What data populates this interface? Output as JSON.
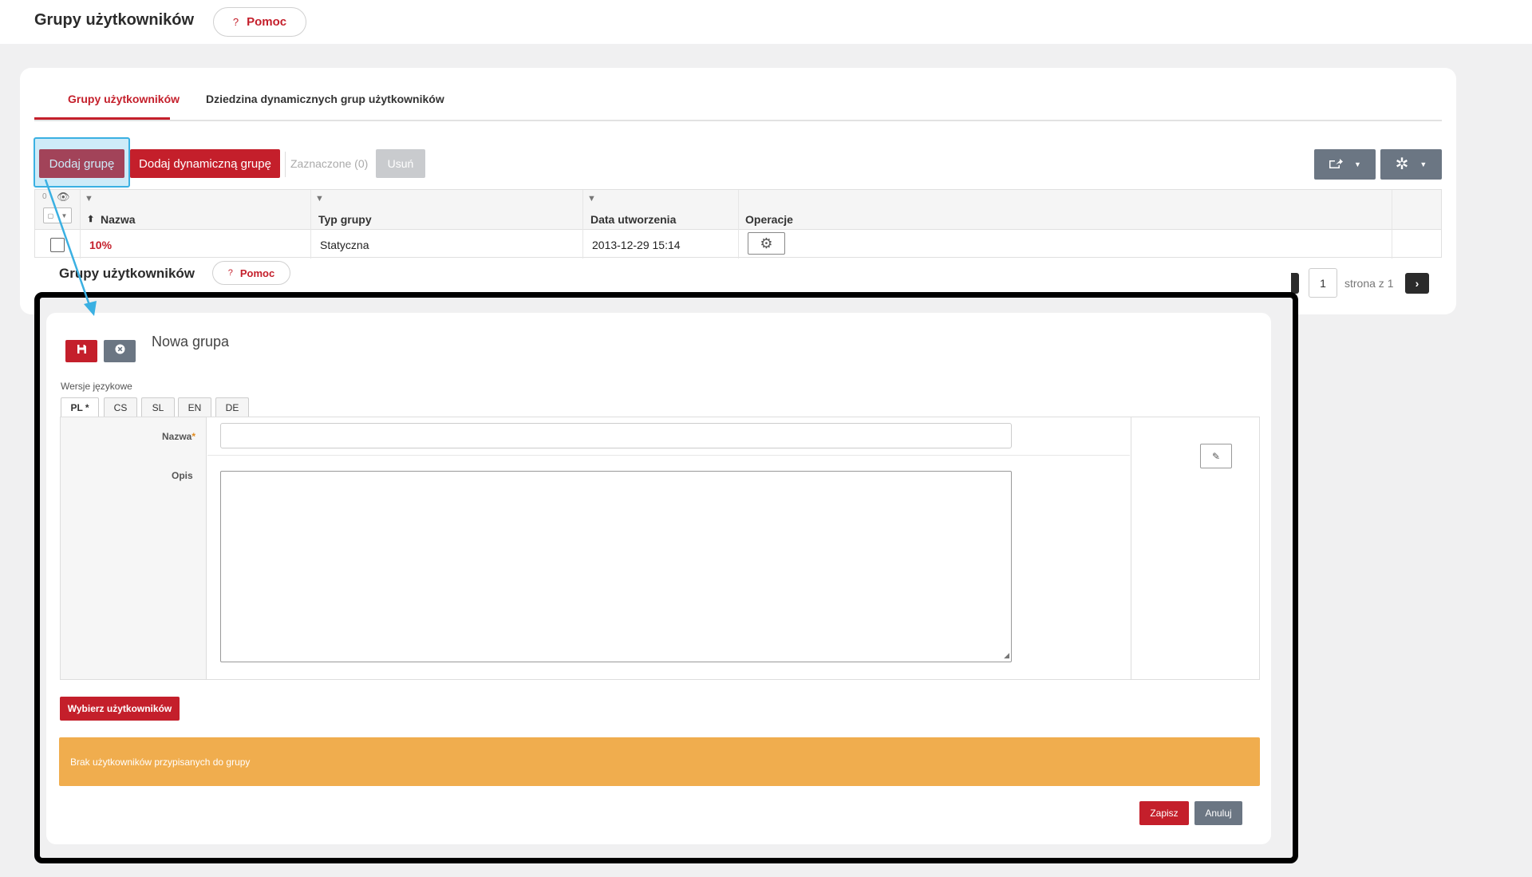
{
  "header": {
    "title": "Grupy użytkowników",
    "help_icon": "?",
    "help_label": "Pomoc"
  },
  "tabs": [
    {
      "label": "Grupy użytkowników",
      "active": true
    },
    {
      "label": "Dziedzina dynamicznych grup użytkowników",
      "active": false
    }
  ],
  "toolbar": {
    "add_group": "Dodaj grupę",
    "add_dynamic_group": "Dodaj dynamiczną grupę",
    "selected": "Zaznaczone (0)",
    "delete": "Usuń",
    "export_icon": "export-icon",
    "settings_icon": "tools-icon"
  },
  "table": {
    "count": "0",
    "columns": [
      "Nazwa",
      "Typ grupy",
      "Data utworzenia",
      "Operacje"
    ],
    "rows": [
      {
        "name": "10%",
        "type": "Statyczna",
        "created": "2013-12-29 15:14"
      }
    ]
  },
  "pager": {
    "page": "1",
    "of_label": "strona z 1"
  },
  "overlay": {
    "title": "Grupy użytkowników",
    "help_icon": "?",
    "help_label": "Pomoc",
    "form_title": "Nowa grupa",
    "lang_label": "Wersje językowe",
    "langs": [
      "PL *",
      "CS",
      "SL",
      "EN",
      "DE"
    ],
    "name_label": "Nazwa",
    "required_mark": "*",
    "desc_label": "Opis",
    "name_value": "",
    "desc_value": "",
    "choose_users": "Wybierz użytkowników",
    "alert": "Brak użytkowników przypisanych do grupy",
    "save": "Zapisz",
    "cancel": "Anuluj"
  },
  "colors": {
    "brand": "#c41f2b",
    "slate": "#6b7683",
    "warning": "#f0ad4e",
    "highlight": "#3ab0e2"
  }
}
